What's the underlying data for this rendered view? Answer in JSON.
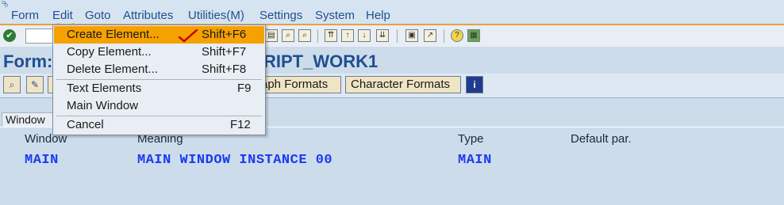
{
  "menubar": {
    "items": [
      {
        "label": "Form"
      },
      {
        "label": "Edit"
      },
      {
        "label": "Goto"
      },
      {
        "label": "Attributes"
      },
      {
        "label": "Utilities(M)"
      },
      {
        "label": "Settings"
      },
      {
        "label": "System"
      },
      {
        "label": "Help"
      }
    ]
  },
  "edit_menu": {
    "items": [
      {
        "label": "Create Element...",
        "shortcut": "Shift+F6"
      },
      {
        "label": "Copy Element...",
        "shortcut": "Shift+F7"
      },
      {
        "label": "Delete Element...",
        "shortcut": "Shift+F8"
      },
      {
        "label": "Text Elements",
        "shortcut": "F9"
      },
      {
        "label": "Main Window",
        "shortcut": ""
      },
      {
        "label": "Cancel",
        "shortcut": "F12"
      }
    ]
  },
  "title": {
    "prefix": "Form:",
    "suffix": "RIPT_WORK1"
  },
  "app_toolbar": {
    "paragraph_formats": "aph Formats",
    "character_formats": "Character Formats"
  },
  "tab": {
    "label": "Window"
  },
  "table": {
    "headers": [
      "Window",
      "Meaning",
      "Type",
      "Default par."
    ],
    "rows": [
      [
        "MAIN",
        "MAIN WINDOW INSTANCE 00",
        "MAIN",
        ""
      ]
    ]
  },
  "colors": {
    "highlight": "#f5a100",
    "link_blue": "#1f4f8f",
    "value_blue": "#1a3aee",
    "annotation_red": "#c40000"
  }
}
